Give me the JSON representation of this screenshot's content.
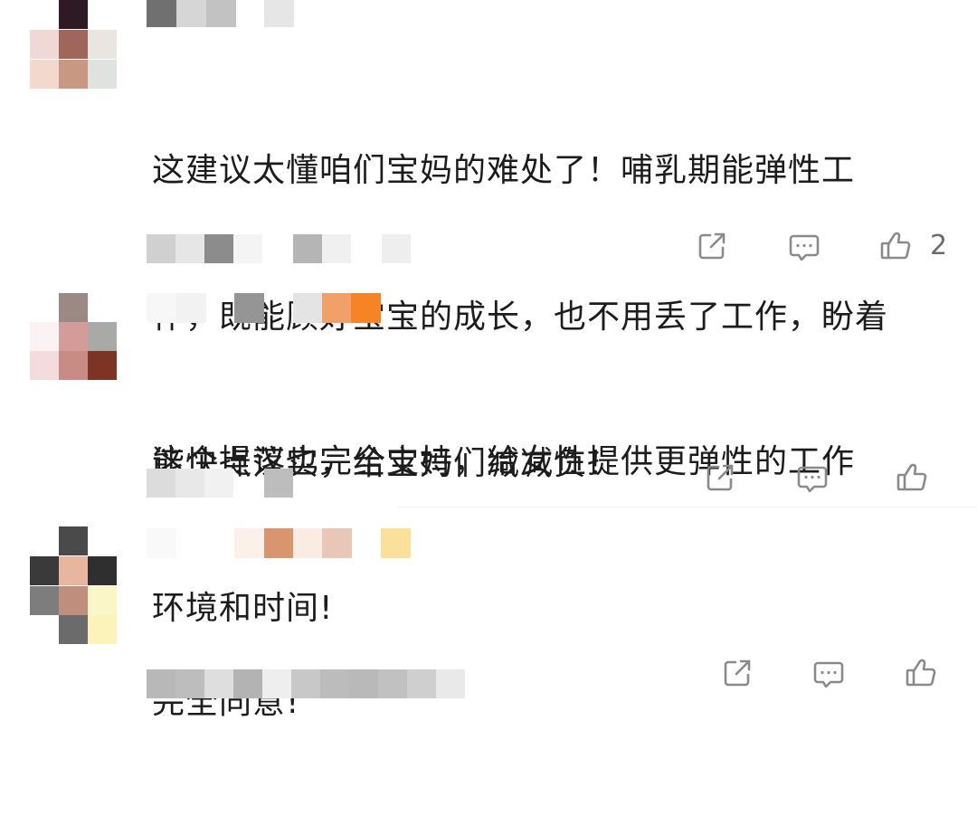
{
  "comments": [
    {
      "text": "这建议太懂咱们宝妈的难处了！哺乳期能弹性工作，既能顾好宝宝的成长，也不用丢了工作，盼着能快点落实，给宝妈们减减负！",
      "lines": [
        "这建议太懂咱们宝妈的难处了！哺乳期能弹性工",
        "作，既能顾好宝宝的成长，也不用丢了工作，盼着",
        "能快点落实，给宝妈们减减负！"
      ],
      "like_count": "2",
      "icons": {
        "share": "share-icon",
        "reply": "comment-icon",
        "like": "thumbs-up-icon"
      }
    },
    {
      "text": "这个提议也完全支持，给女性提供更弹性的工作环境和时间!",
      "lines": [
        "这个提议也完全支持，给女性提供更弹性的工作",
        "环境和时间!"
      ],
      "like_count": "",
      "icons": {
        "share": "share-icon",
        "reply": "comment-icon",
        "like": "thumbs-up-icon"
      }
    },
    {
      "text": "完全同意!",
      "lines": [
        "完全同意!"
      ],
      "like_count": "",
      "icons": {
        "share": "share-icon",
        "reply": "comment-icon",
        "like": "thumbs-up-icon"
      }
    }
  ],
  "colors": {
    "icon": "#8a8a8a",
    "text": "#1c1c1c",
    "count": "#6b6b6b"
  }
}
